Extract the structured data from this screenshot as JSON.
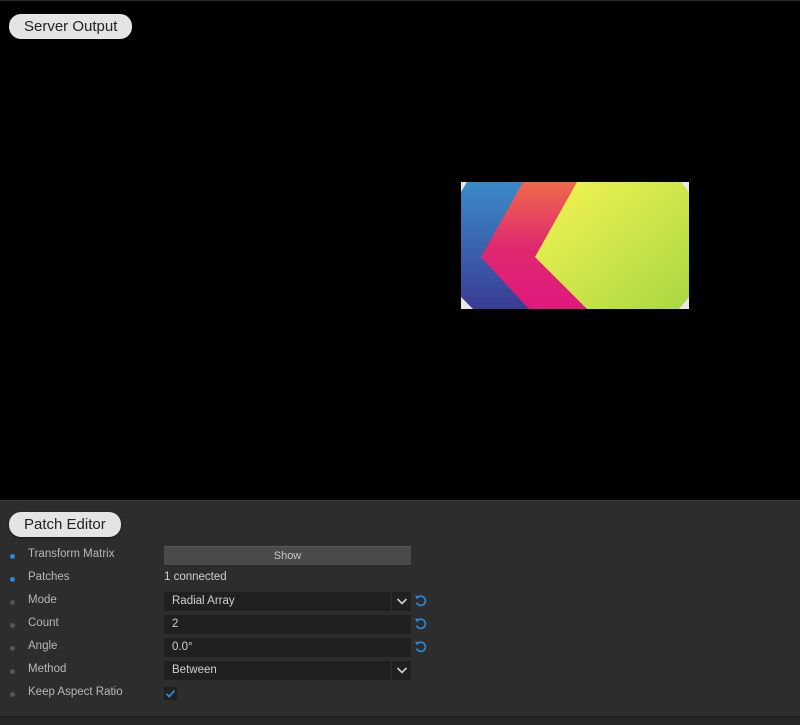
{
  "server_output": {
    "title": "Server Output"
  },
  "patch_editor": {
    "title": "Patch Editor",
    "transform_matrix": {
      "label": "Transform Matrix",
      "button": "Show"
    },
    "patches": {
      "label": "Patches",
      "value": "1 connected"
    },
    "mode": {
      "label": "Mode",
      "value": "Radial Array"
    },
    "count": {
      "label": "Count",
      "value": "2"
    },
    "angle": {
      "label": "Angle",
      "value": "0.0°"
    },
    "method": {
      "label": "Method",
      "value": "Between"
    },
    "keep_aspect_ratio": {
      "label": "Keep Aspect Ratio",
      "checked": true
    }
  },
  "colors": {
    "accent": "#2a8ad8",
    "panel": "#2d2d2d",
    "field": "#202020"
  },
  "icons": {
    "reset": "reset-icon",
    "dropdown": "chevron-down-icon",
    "check": "check-icon"
  }
}
